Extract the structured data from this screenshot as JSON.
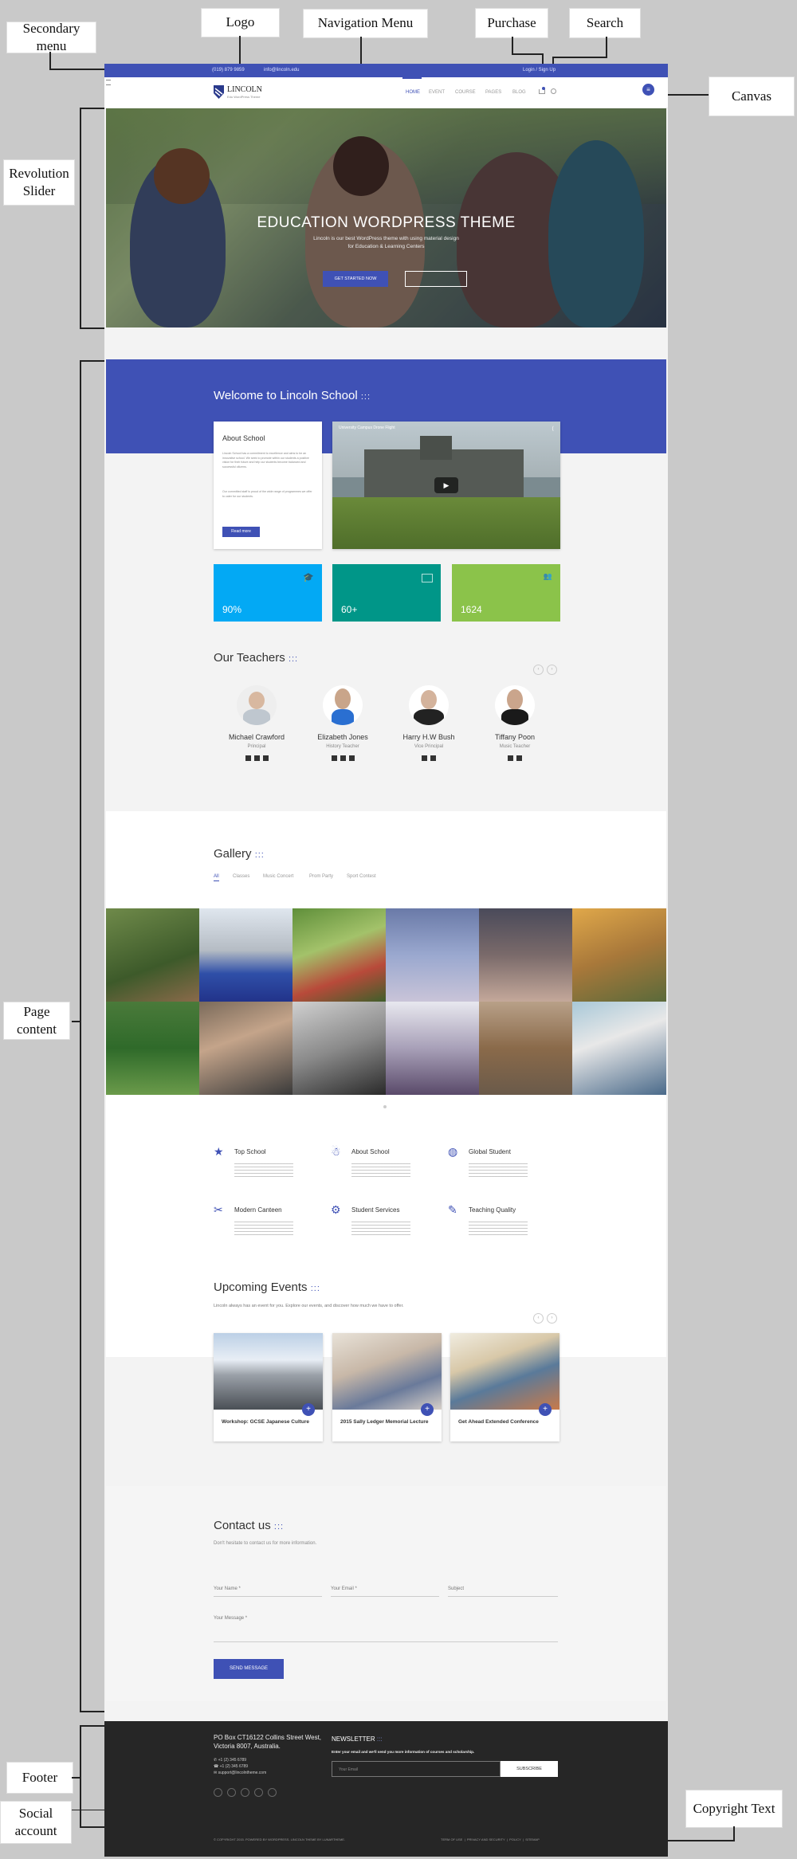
{
  "callouts": {
    "secondary_menu": "Secondary menu",
    "logo": "Logo",
    "navigation_menu": "Navigation Menu",
    "purchase": "Purchase",
    "search": "Search",
    "canvas": "Canvas",
    "revolution_slider": "Revolution Slider",
    "page_content": "Page content",
    "footer": "Footer",
    "social_account": "Social account",
    "copyright_text": "Copyright Text"
  },
  "topbar": {
    "phone": "(019) 879 9859",
    "email": "info@lincoln.edu",
    "login": "Login / Sign Up"
  },
  "brand": {
    "name": "LINCOLN",
    "tagline": "Edu WordPress Theme"
  },
  "nav": [
    "HOME",
    "EVENT",
    "COURSE",
    "PAGES",
    "BLOG"
  ],
  "hero": {
    "title": "EDUCATION WORDPRESS THEME",
    "subtitle_1": "Lincoln is our best WordPress theme with using material design",
    "subtitle_2": "for Education & Learning Centers",
    "cta": "GET STARTED NOW"
  },
  "welcome": {
    "title": "Welcome to Lincoln School",
    "dots": ":::",
    "about_title": "About School",
    "about_text_1": "Lincoln School has a commitment to excellence and aims to be an innovative school. We seek to promote within our students a positive vision for their future and help our students become balanced and successful citizens.",
    "about_text_2": "Our committed staff is proud of the wide range of programmes we offer to cater for our students.",
    "read_more": "Read more",
    "video_title": "University Campus Drone Flight",
    "stats": [
      "90%",
      "60+",
      "1624"
    ]
  },
  "teachers": {
    "title": "Our Teachers",
    "dots": ":::",
    "items": [
      {
        "name": "Michael Crawford",
        "role": "Principal"
      },
      {
        "name": "Elizabeth Jones",
        "role": "History Teacher"
      },
      {
        "name": "Harry H.W Bush",
        "role": "Vice Principal"
      },
      {
        "name": "Tiffany Poon",
        "role": "Music Teacher"
      }
    ]
  },
  "gallery": {
    "title": "Gallery",
    "dots": ":::",
    "filters": [
      "All",
      "Classes",
      "Music Concert",
      "Prom Party",
      "Sport Contest"
    ]
  },
  "features": [
    {
      "icon": "★",
      "title": "Top School"
    },
    {
      "icon": "☃",
      "title": "About School"
    },
    {
      "icon": "◍",
      "title": "Global Student"
    },
    {
      "icon": "✂",
      "title": "Modern Canteen"
    },
    {
      "icon": "⚙",
      "title": "Student Services"
    },
    {
      "icon": "✎",
      "title": "Teaching Quality"
    }
  ],
  "events": {
    "title": "Upcoming Events",
    "dots": ":::",
    "subtitle": "Lincoln always has an event for you. Explore our events, and discover how much we have to offer.",
    "items": [
      "Workshop: GCSE Japanese Culture",
      "2015 Sally Ledger Memorial Lecture",
      "Get Ahead Extended Conference"
    ]
  },
  "contact": {
    "title": "Contact us",
    "dots": ":::",
    "subtitle": "Don't hesitate to contact us for more information.",
    "name_label": "Your Name *",
    "email_label": "Your Email *",
    "subject_label": "Subject",
    "message_label": "Your Message *",
    "send": "SEND MESSAGE"
  },
  "footer": {
    "address_1": "PO Box CT16122 Collins Street West,",
    "address_2": "Victoria 8007, Australia.",
    "phone_1": "+1 (2) 345 6789",
    "phone_2": "+1 (2) 345 6789",
    "email": "support@lincolntheme.com",
    "newsletter_title": "NEWSLETTER",
    "dots": ":::",
    "newsletter_text": "Enter your email and we'll send you more information of courses and scholarship.",
    "email_placeholder": "Your Email",
    "subscribe": "SUBSCRIBE",
    "copyright": "© COPYRIGHT 2015. POWERED BY WORDPRESS. LINCOLN THEME BY LUNARTHEME.",
    "links": [
      "TERM OF USE",
      "PRIVACY AND SECURITY",
      "POLICY",
      "SITEMAP"
    ]
  },
  "colors": {
    "primary": "#3f51b5",
    "stat_blue": "#03a9f4",
    "stat_teal": "#009688",
    "stat_green": "#8bc34a",
    "footer": "#262626"
  }
}
